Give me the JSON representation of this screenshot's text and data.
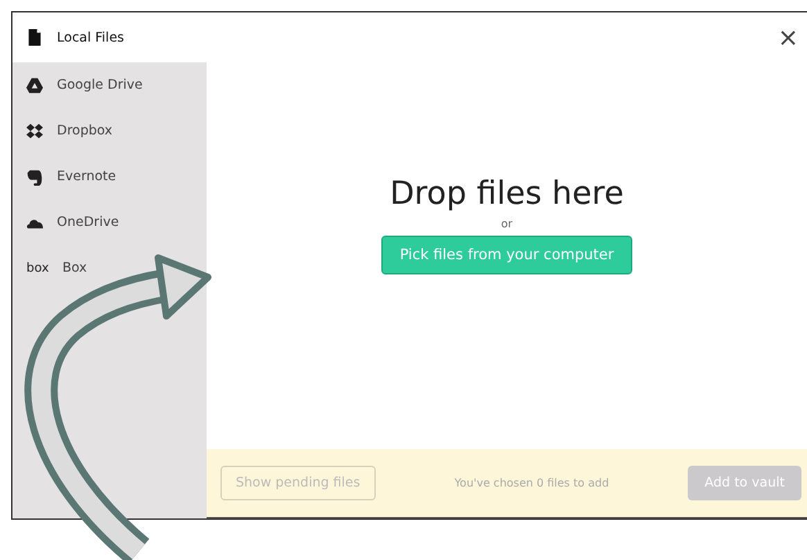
{
  "sidebar": {
    "items": [
      {
        "label": "Local Files",
        "kind": "file",
        "selected": true
      },
      {
        "label": "Google Drive",
        "kind": "drive",
        "selected": false
      },
      {
        "label": "Dropbox",
        "kind": "dropbox",
        "selected": false
      },
      {
        "label": "Evernote",
        "kind": "evernote",
        "selected": false
      },
      {
        "label": "OneDrive",
        "kind": "cloud",
        "selected": false
      },
      {
        "label": "Box",
        "kind": "box",
        "icon_text": "box",
        "selected": false
      }
    ]
  },
  "close": "×",
  "drop": {
    "title": "Drop files here",
    "or": "or",
    "button": "Pick files from your computer"
  },
  "footer": {
    "pending": {
      "label": "Show pending files",
      "disabled": true
    },
    "status": "You've chosen 0 files to add",
    "add": {
      "label": "Add to vault",
      "disabled": true
    }
  }
}
